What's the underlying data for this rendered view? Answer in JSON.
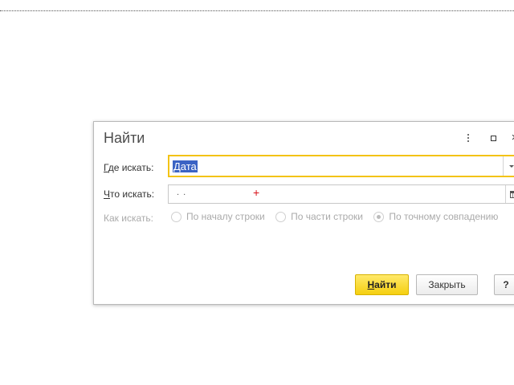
{
  "dialog": {
    "title": "Найти",
    "controls": {
      "menu_icon": "kebab-menu-icon",
      "maximize_icon": "maximize-icon",
      "close_icon": "close-icon",
      "close_glyph": "×"
    },
    "where": {
      "label_mnemonic": "Г",
      "label_rest": "де искать:",
      "value": "Дата",
      "dropdown_icon": "chevron-down-icon"
    },
    "what": {
      "label_mnemonic": "Ч",
      "label_rest": "то искать:",
      "mask": ".  .",
      "cursor_glyph": "+",
      "calendar_icon": "calendar-icon"
    },
    "how": {
      "label": "Как искать:",
      "options": [
        {
          "label": "По началу строки",
          "selected": false
        },
        {
          "label": "По части строки",
          "selected": false
        },
        {
          "label": "По точному совпадению",
          "selected": true
        }
      ]
    },
    "buttons": {
      "find_mnemonic": "Н",
      "find_rest": "айти",
      "close": "Закрыть",
      "help": "?"
    }
  },
  "colors": {
    "accent_focus": "#f3c316",
    "primary_button": "#f5cf10",
    "selection": "#3b63c4"
  }
}
